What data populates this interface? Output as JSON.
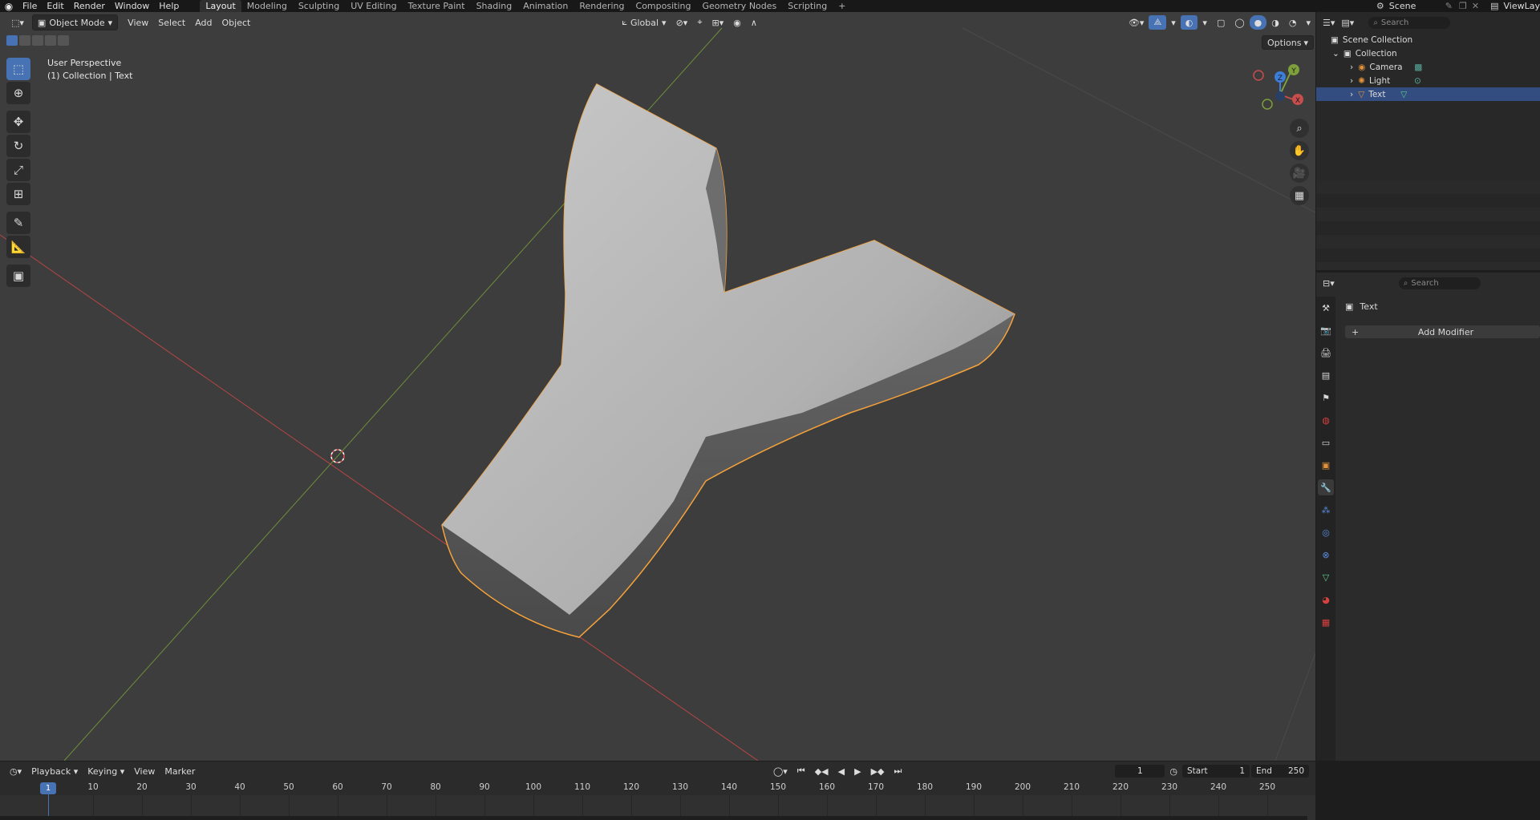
{
  "menu": {
    "items": [
      "File",
      "Edit",
      "Render",
      "Window",
      "Help"
    ]
  },
  "workspaces": {
    "tabs": [
      "Layout",
      "Modeling",
      "Sculpting",
      "UV Editing",
      "Texture Paint",
      "Shading",
      "Animation",
      "Rendering",
      "Compositing",
      "Geometry Nodes",
      "Scripting"
    ],
    "add": "+"
  },
  "top_right": {
    "scene": "Scene",
    "view_layer": "ViewLay"
  },
  "viewport_header": {
    "mode": "Object Mode",
    "menus": [
      "View",
      "Select",
      "Add",
      "Object"
    ],
    "orientation": "Global",
    "options": "Options"
  },
  "viewport": {
    "perspective": "User Perspective",
    "collection_info": "(1) Collection | Text",
    "gizmo": {
      "x": "X",
      "y": "Y",
      "z": "Z"
    }
  },
  "outliner": {
    "search_placeholder": "Search",
    "root": "Scene Collection",
    "collection": "Collection",
    "objects": [
      {
        "name": "Camera",
        "icon": "camera-icon",
        "selected": false
      },
      {
        "name": "Light",
        "icon": "light-icon",
        "selected": false
      },
      {
        "name": "Text",
        "icon": "mesh-icon",
        "selected": true
      }
    ]
  },
  "properties": {
    "search_placeholder": "Search",
    "object_name": "Text",
    "add_modifier": "Add Modifier",
    "add_icon": "+"
  },
  "timeline_header": {
    "menus": [
      "Playback",
      "Keying",
      "View",
      "Marker"
    ],
    "current_frame": "1",
    "start_label": "Start",
    "start_value": "1",
    "end_label": "End",
    "end_value": "250"
  },
  "timeline": {
    "current": "1",
    "ticks": [
      "10",
      "20",
      "30",
      "40",
      "50",
      "60",
      "70",
      "80",
      "90",
      "100",
      "110",
      "120",
      "130",
      "140",
      "150",
      "160",
      "170",
      "180",
      "190",
      "200",
      "210",
      "220",
      "230",
      "240",
      "250"
    ]
  },
  "colors": {
    "accent": "#4772b3",
    "selection_outline": "#f7a33a",
    "x_axis": "#c84d4d",
    "y_axis": "#7da03c",
    "z_axis": "#3d7fd8"
  }
}
